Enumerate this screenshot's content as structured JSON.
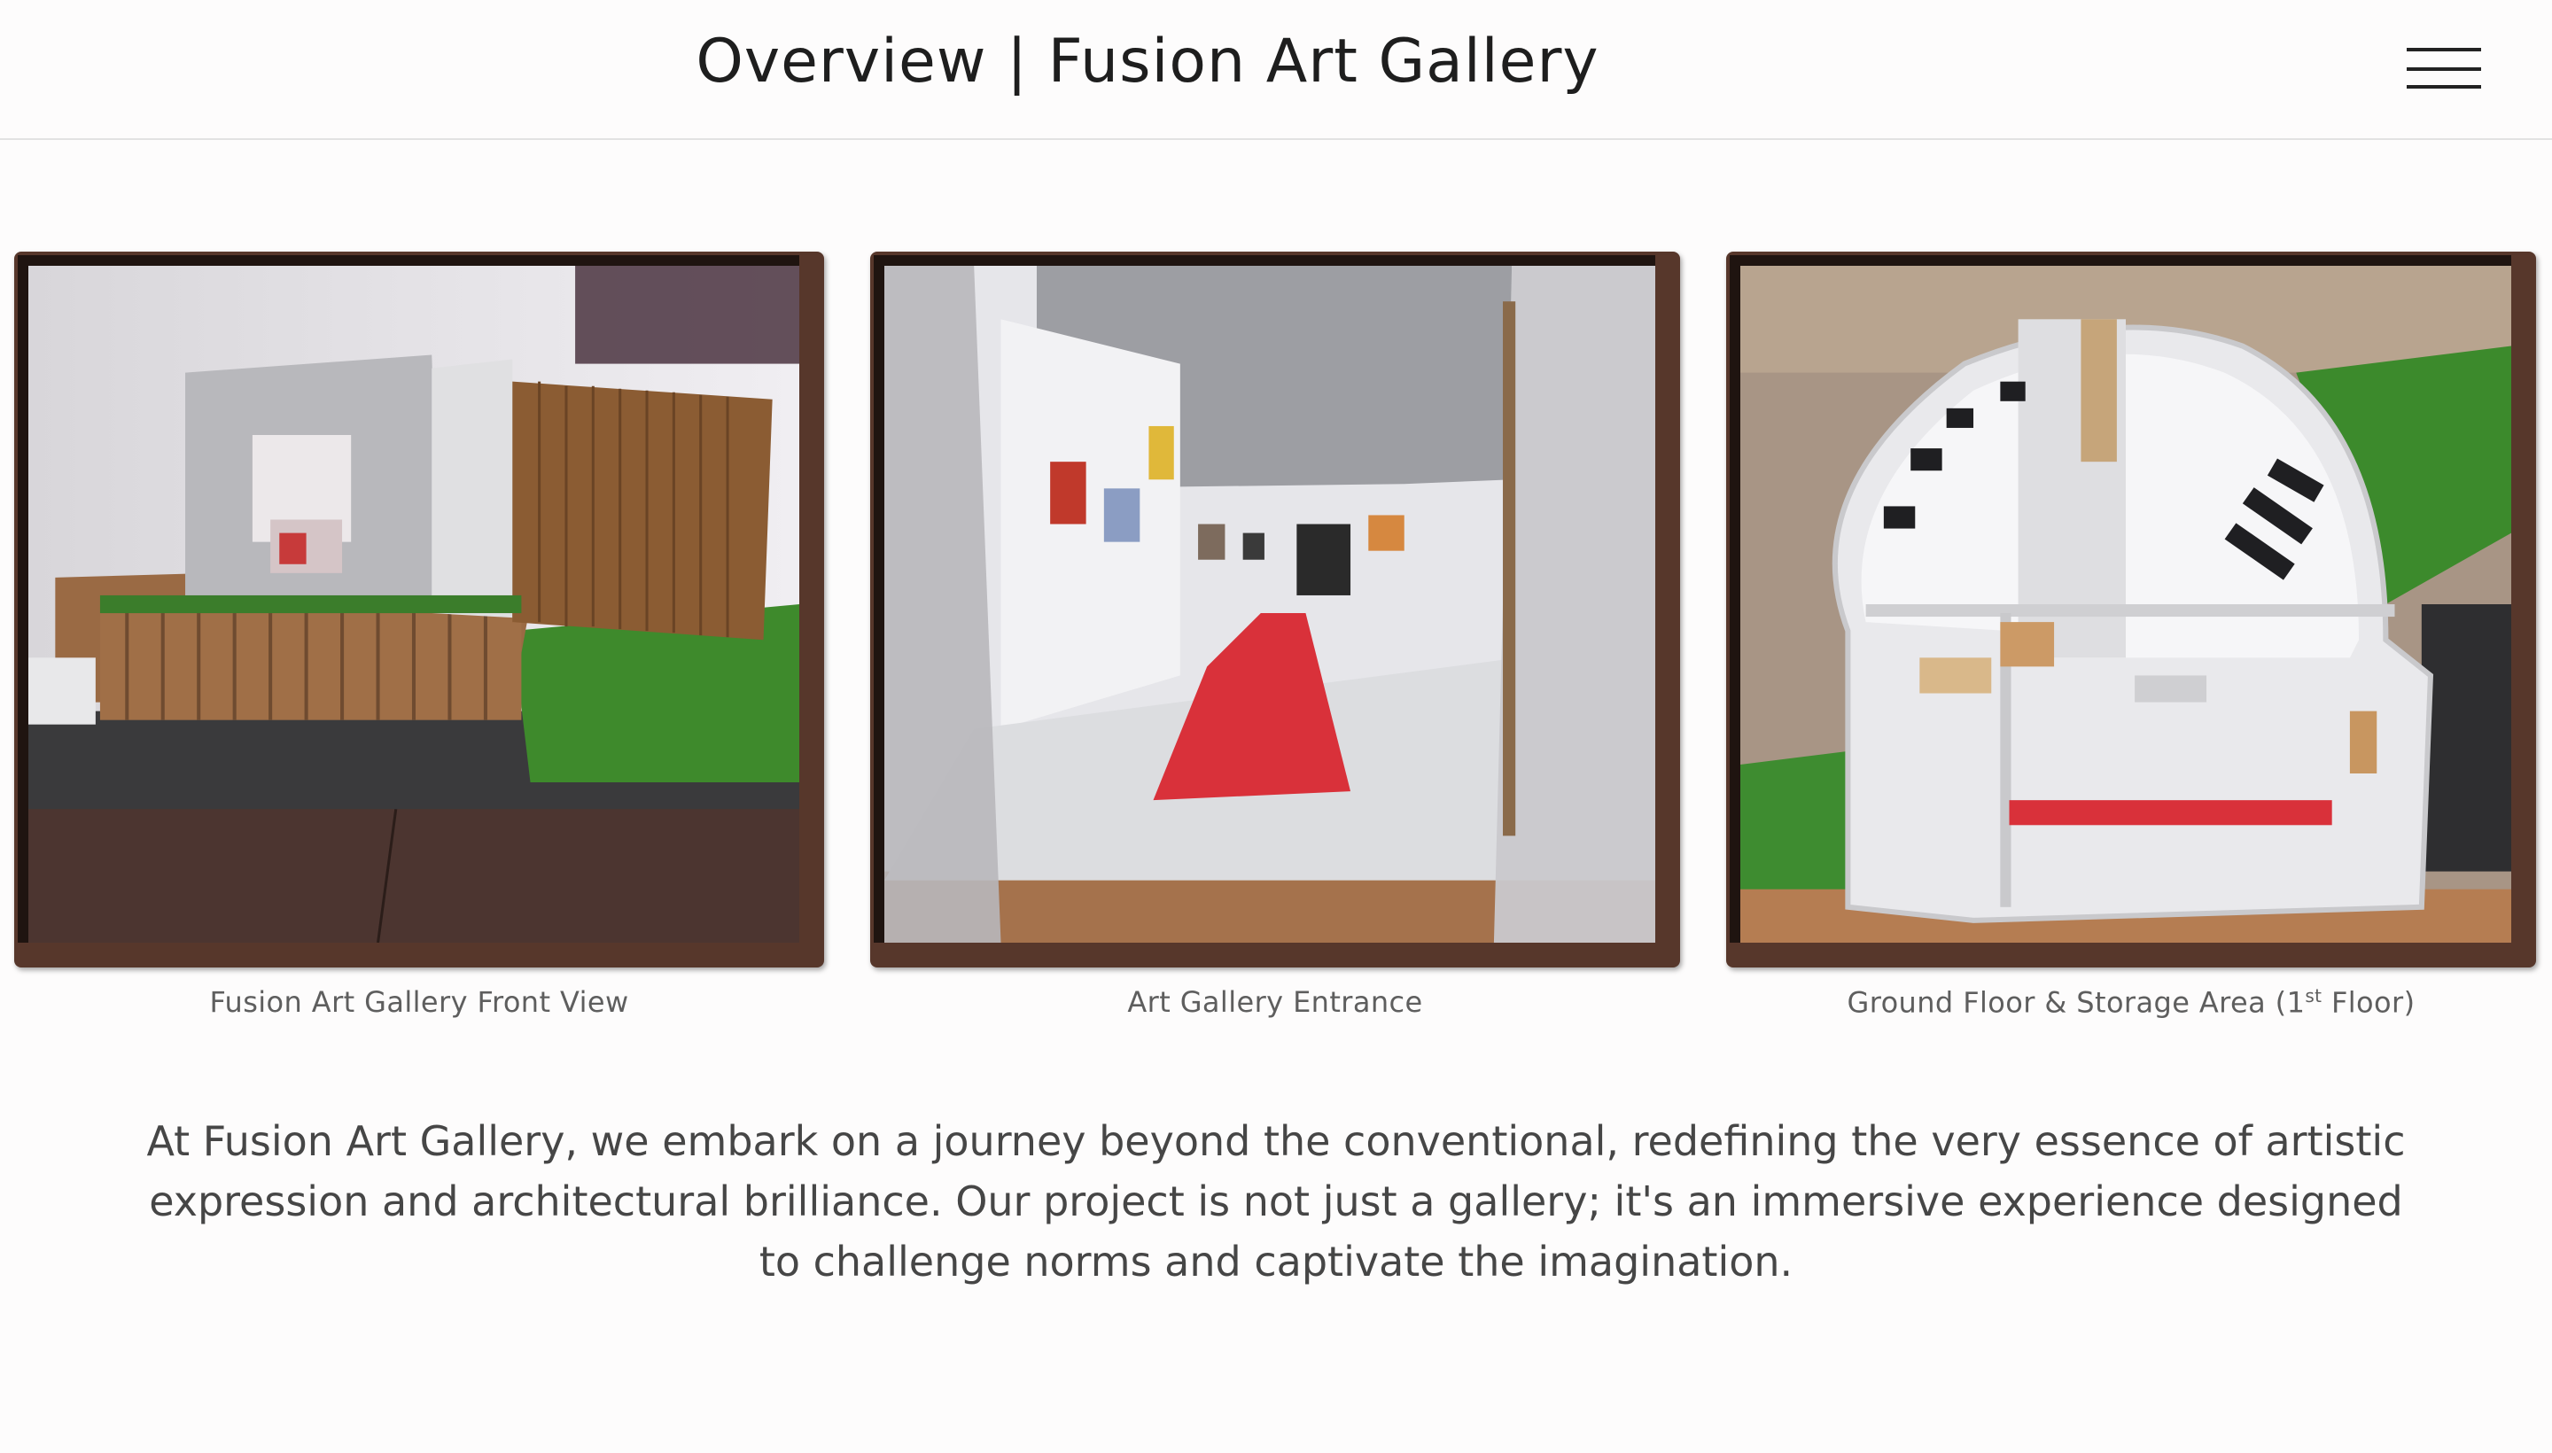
{
  "header": {
    "title": "Overview | Fusion Art Gallery",
    "menu_icon": "hamburger-menu-icon"
  },
  "gallery": {
    "items": [
      {
        "caption": "Fusion Art Gallery Front View"
      },
      {
        "caption": "Art Gallery Entrance"
      },
      {
        "caption_main": "Ground Floor & Storage Area (1",
        "caption_sup": "st",
        "caption_end": " Floor)"
      }
    ]
  },
  "intro": {
    "text": "At Fusion Art Gallery, we embark on a journey beyond the conventional, redefining the very essence of artistic expression and architectural brilliance. Our project is not just a gallery; it's an immersive experience designed to challenge norms and captivate the imagination."
  },
  "colors": {
    "frame": "#57372b",
    "frame_inner": "#1f1410",
    "background": "#fdfcfc",
    "accent_red": "#d9313a"
  }
}
